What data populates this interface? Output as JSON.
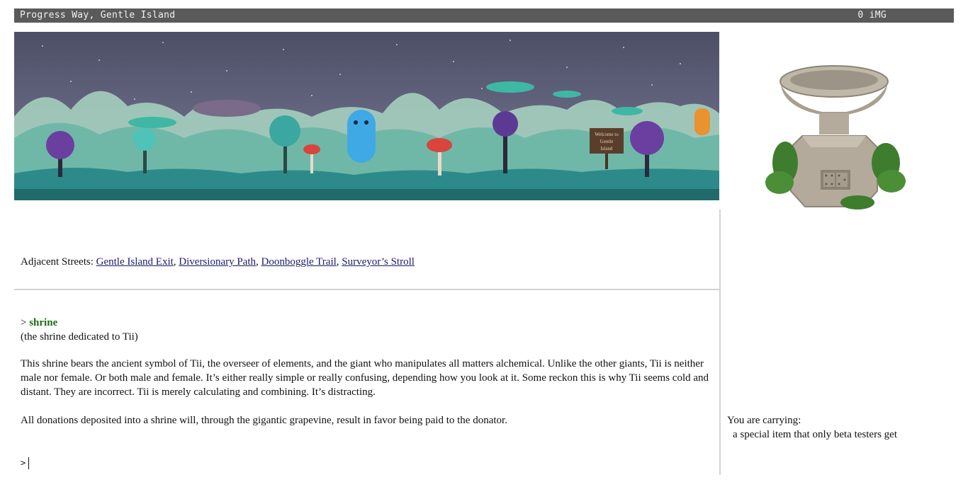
{
  "header": {
    "location": "Progress Way, Gentle Island",
    "currency": "0 iMG"
  },
  "banner": {
    "sign_text": [
      "Welcome to",
      "Gentle",
      "Island"
    ]
  },
  "streets": {
    "label": "Adjacent Streets:",
    "links": [
      "Gentle Island Exit",
      "Diversionary Path",
      "Doonboggle Trail",
      "Surveyor’s Stroll"
    ]
  },
  "output": {
    "prompt_symbol": ">",
    "command": "shrine",
    "subtitle": "(the shrine dedicated to Tii)",
    "description": "This shrine bears the ancient symbol of Tii, the overseer of elements, and the giant who manipulates all matters alchemical. Unlike the other giants, Tii is neither male nor female. Or both male and female. It’s either really simple or really confusing, depending how you look at it. Some reckon this is why Tii seems cold and distant. They are incorrect. Tii is merely calculating and combining. It’s distracting.",
    "donation_note": "All donations deposited into a shrine will, through the gigantic grapevine, result in favor being paid to the donator."
  },
  "input": {
    "prompt_symbol": ">",
    "value": ""
  },
  "inventory": {
    "label": "You are carrying:",
    "items": [
      "a special item that only beta testers get"
    ]
  }
}
